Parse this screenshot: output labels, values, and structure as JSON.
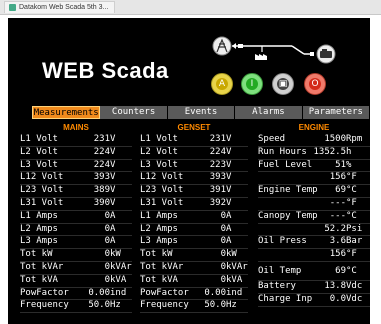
{
  "browser": {
    "tab_title": "Datakom Web Scada 5th 3..."
  },
  "app": {
    "title": "WEB Scada"
  },
  "controls": [
    {
      "name": "auto-mode-button",
      "glyph": "A"
    },
    {
      "name": "start-button",
      "glyph": "I"
    },
    {
      "name": "manual-mode-button",
      "glyph": "▣"
    },
    {
      "name": "stop-button",
      "glyph": "O"
    }
  ],
  "nav": {
    "tabs": [
      "Measurements",
      "Counters",
      "Events",
      "Alarms",
      "Parameters"
    ],
    "active": "Measurements"
  },
  "mains": {
    "title": "MAINS",
    "rows": [
      {
        "label": "L1 Volt",
        "value": "231",
        "unit": "V"
      },
      {
        "label": "L2 Volt",
        "value": "224",
        "unit": "V"
      },
      {
        "label": "L3 Volt",
        "value": "224",
        "unit": "V"
      },
      {
        "label": "L12 Volt",
        "value": "393",
        "unit": "V"
      },
      {
        "label": "L23 Volt",
        "value": "389",
        "unit": "V"
      },
      {
        "label": "L31 Volt",
        "value": "390",
        "unit": "V"
      },
      {
        "label": "L1 Amps",
        "value": "0",
        "unit": "A"
      },
      {
        "label": "L2 Amps",
        "value": "0",
        "unit": "A"
      },
      {
        "label": "L3 Amps",
        "value": "0",
        "unit": "A"
      },
      {
        "label": "Tot kW",
        "value": "0",
        "unit": "kW"
      },
      {
        "label": "Tot kVAr",
        "value": "0",
        "unit": "kVAr"
      },
      {
        "label": "Tot kVA",
        "value": "0",
        "unit": "kVA"
      },
      {
        "label": "PowFactor",
        "value": "0.00",
        "unit": "ind"
      },
      {
        "label": "Frequency",
        "value": "50.0",
        "unit": "Hz"
      }
    ]
  },
  "genset": {
    "title": "GENSET",
    "rows": [
      {
        "label": "L1 Volt",
        "value": "231",
        "unit": "V"
      },
      {
        "label": "L2 Volt",
        "value": "224",
        "unit": "V"
      },
      {
        "label": "L3 Volt",
        "value": "223",
        "unit": "V"
      },
      {
        "label": "L12 Volt",
        "value": "393",
        "unit": "V"
      },
      {
        "label": "L23 Volt",
        "value": "391",
        "unit": "V"
      },
      {
        "label": "L31 Volt",
        "value": "392",
        "unit": "V"
      },
      {
        "label": "L1 Amps",
        "value": "0",
        "unit": "A"
      },
      {
        "label": "L2 Amps",
        "value": "0",
        "unit": "A"
      },
      {
        "label": "L3 Amps",
        "value": "0",
        "unit": "A"
      },
      {
        "label": "Tot kW",
        "value": "0",
        "unit": "kW"
      },
      {
        "label": "Tot kVAr",
        "value": "0",
        "unit": "kVAr"
      },
      {
        "label": "Tot kVA",
        "value": "0",
        "unit": "kVA"
      },
      {
        "label": "PowFactor",
        "value": "0.00",
        "unit": "ind"
      },
      {
        "label": "Frequency",
        "value": "50.0",
        "unit": "Hz"
      }
    ]
  },
  "engine": {
    "title": "ENGINE",
    "rows": [
      {
        "label": "Speed",
        "value": "1500",
        "unit": "Rpm",
        "gap": false
      },
      {
        "label": "Run Hours",
        "value": "1352.5",
        "unit": "h",
        "gap": false
      },
      {
        "label": "Fuel Level",
        "value": "51",
        "unit": "%",
        "gap": false
      },
      {
        "label": "",
        "value": "156",
        "unit": "°F",
        "gap": false
      },
      {
        "label": "Engine Temp",
        "value": "69",
        "unit": "°C",
        "gap": false
      },
      {
        "label": "",
        "value": "---",
        "unit": "°F",
        "gap": false
      },
      {
        "label": "Canopy Temp",
        "value": "---",
        "unit": "°C",
        "gap": false
      },
      {
        "label": "",
        "value": "52.2",
        "unit": "Psi",
        "gap": false
      },
      {
        "label": "Oil Press",
        "value": "3.6",
        "unit": "Bar",
        "gap": false
      },
      {
        "label": "",
        "value": "156",
        "unit": "°F",
        "gap": false
      },
      {
        "label": "Oil Temp",
        "value": "69",
        "unit": "°C",
        "gap": true
      },
      {
        "label": "Battery",
        "value": "13.8",
        "unit": "Vdc",
        "gap": false
      },
      {
        "label": "Charge Inp",
        "value": "0.0",
        "unit": "Vdc",
        "gap": false
      }
    ]
  }
}
